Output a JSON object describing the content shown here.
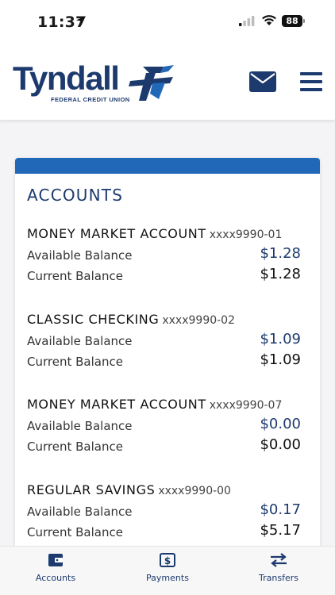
{
  "status_bar": {
    "time": "11:37",
    "battery": "88"
  },
  "brand": {
    "name": "Tyndall",
    "tagline": "FEDERAL CREDIT UNION"
  },
  "colors": {
    "brand_navy": "#1d3a6e",
    "accent_blue": "#2169b8"
  },
  "header": {
    "icons": [
      "mail-icon",
      "hamburger-menu-icon"
    ]
  },
  "accounts_card": {
    "title": "ACCOUNTS",
    "accounts": [
      {
        "name": "MONEY MARKET ACCOUNT",
        "number": "xxxx9990-01",
        "available_label": "Available Balance",
        "available": "$1.28",
        "current_label": "Current Balance",
        "current": "$1.28"
      },
      {
        "name": "CLASSIC CHECKING",
        "number": "xxxx9990-02",
        "available_label": "Available Balance",
        "available": "$1.09",
        "current_label": "Current Balance",
        "current": "$1.09"
      },
      {
        "name": "MONEY MARKET ACCOUNT",
        "number": "xxxx9990-07",
        "available_label": "Available Balance",
        "available": "$0.00",
        "current_label": "Current Balance",
        "current": "$0.00"
      },
      {
        "name": "REGULAR SAVINGS",
        "number": "xxxx9990-00",
        "available_label": "Available Balance",
        "available": "$0.17",
        "current_label": "Current Balance",
        "current": "$5.17"
      }
    ]
  },
  "bottom_nav": {
    "items": [
      {
        "label": "Accounts",
        "icon": "wallet-icon"
      },
      {
        "label": "Payments",
        "icon": "dollar-bill-icon"
      },
      {
        "label": "Transfers",
        "icon": "transfer-arrows-icon"
      }
    ]
  }
}
